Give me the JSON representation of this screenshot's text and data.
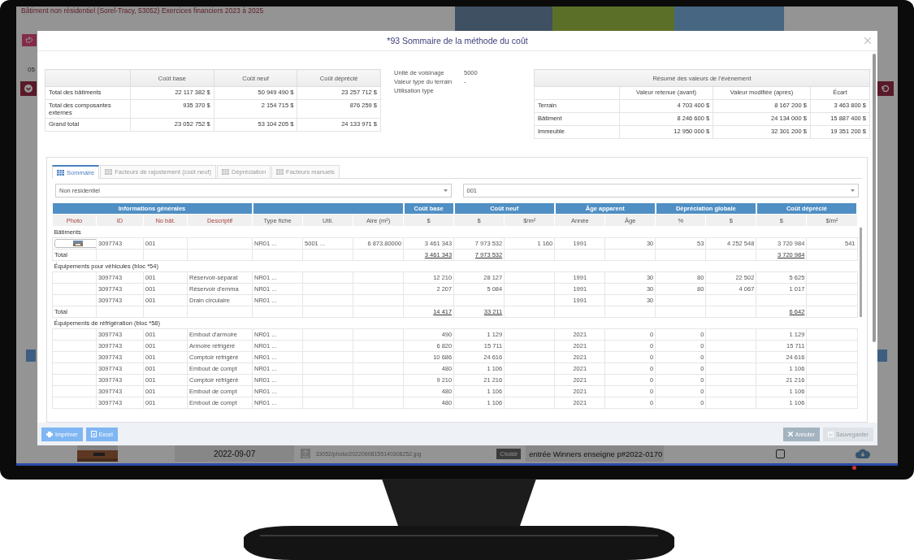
{
  "background": {
    "title": "Bâtiment non résidentiel (Sorel-Tracy, 53052) Exercices financiers 2023 à 2025",
    "number": "05",
    "bottom_row": {
      "date": "2022-09-07",
      "file": "33052/photo/20220908155140308252.jpg",
      "choose_button": "Choisir",
      "description": "entrée Winners enseigne p#2022-0170",
      "checked": false
    }
  },
  "modal": {
    "title": "*93 Sommaire de la méthode du coût",
    "cost_table": {
      "columns": [
        "Coût base",
        "Coût neuf",
        "Coût déprécié"
      ],
      "rows": [
        {
          "label": "Total des bâtiments",
          "values": [
            "22 117 382 $",
            "50 949 490 $",
            "23 257 712 $"
          ]
        },
        {
          "label": "Total des composantes externes",
          "values": [
            "935 370 $",
            "2 154 715 $",
            "876 259 $"
          ]
        },
        {
          "label": "Grand total",
          "values": [
            "23 052 752 $",
            "53 104 205 $",
            "24 133 971 $"
          ]
        }
      ]
    },
    "info": [
      {
        "label": "Unité de voisinage",
        "value": "5000"
      },
      {
        "label": "Valeur type du terrain",
        "value": "-"
      },
      {
        "label": "Utilisation type"
      }
    ],
    "event_table": {
      "title": "Résumé des valeurs de l'évènement",
      "columns": [
        "Valeur retenue (avant)",
        "Valeur modifiée (après)",
        "Écart"
      ],
      "rows": [
        {
          "label": "Terrain",
          "values": [
            "4 703 400 $",
            "8 167 200 $",
            "3 463 800 $"
          ]
        },
        {
          "label": "Bâtiment",
          "values": [
            "8 246 600 $",
            "24 134 000 $",
            "15 887 400 $"
          ]
        },
        {
          "label": "Immeuble",
          "values": [
            "12 950 000 $",
            "32 301 200 $",
            "19 351 200 $"
          ]
        }
      ]
    },
    "tabs": [
      {
        "label": "Sommaire",
        "selected": true
      },
      {
        "label": "Facteurs de rajustement (coût neuf)",
        "selected": false
      },
      {
        "label": "Dépréciation",
        "selected": false
      },
      {
        "label": "Facteurs manuels",
        "selected": false
      }
    ],
    "selects": [
      {
        "value": "Non résidentiel"
      },
      {
        "value": "001"
      }
    ],
    "grid": {
      "groups": [
        {
          "label": "Informations générales",
          "columns": [
            {
              "label": "Photo",
              "kind": "key"
            },
            {
              "label": "ID",
              "kind": "key"
            },
            {
              "label": "No bât.",
              "kind": "key"
            },
            {
              "label": "Descriptif",
              "kind": "key"
            }
          ]
        },
        {
          "columns": [
            {
              "label": "Type fiche",
              "kind": "data"
            },
            {
              "label": "Util.",
              "kind": "data"
            },
            {
              "label": "Aire (m²)",
              "kind": "data"
            }
          ]
        },
        {
          "label": "Coût base",
          "columns": [
            {
              "label": "$",
              "kind": "data"
            }
          ]
        },
        {
          "label": "Coût neuf",
          "columns": [
            {
              "label": "$",
              "kind": "data"
            },
            {
              "label": "$/m²",
              "kind": "data"
            }
          ]
        },
        {
          "label": "Âge apparent",
          "columns": [
            {
              "label": "Année",
              "kind": "data"
            },
            {
              "label": "Âge",
              "kind": "data"
            }
          ]
        },
        {
          "label": "Dépréciation globale",
          "columns": [
            {
              "label": "%",
              "kind": "data"
            },
            {
              "label": "$",
              "kind": "data"
            }
          ]
        },
        {
          "label": "Coût déprécié",
          "columns": [
            {
              "label": "$",
              "kind": "data"
            },
            {
              "label": "$/m²",
              "kind": "data"
            }
          ]
        }
      ],
      "sections": [
        {
          "title": "Bâtiments",
          "rows": [
            {
              "photo": true,
              "cells": [
                "3097743",
                "001",
                null,
                "NR01 ...",
                "5001 ...",
                "6 873.80000",
                "3 461 343",
                "7 973 532",
                "1 160",
                "1991",
                "30",
                "53",
                "4 252 548",
                "3 720 984",
                "541"
              ]
            }
          ],
          "total": {
            "label": "Total",
            "cells": [
              null,
              null,
              null,
              null,
              null,
              null,
              "3 461 343",
              "7 973 532",
              null,
              null,
              null,
              null,
              null,
              "3 720 984",
              null
            ]
          }
        },
        {
          "title": "Équipements pour véhicules (bloc *54)",
          "rows": [
            {
              "photo": false,
              "cells": [
                "3097743",
                "001",
                "Réservoir-séparat",
                "NR01 ...",
                null,
                null,
                "12 210",
                "28 127",
                null,
                "1991",
                "30",
                "80",
                "22 502",
                "5 625",
                null
              ]
            },
            {
              "photo": false,
              "cells": [
                "3097743",
                "001",
                "Réservoir d'emma",
                "NR01 ...",
                null,
                null,
                "2 207",
                "5 084",
                null,
                "1991",
                "30",
                "80",
                "4 067",
                "1 017",
                null
              ]
            },
            {
              "photo": false,
              "cells": [
                "3097743",
                "001",
                "Drain circulaire",
                "NR01 ...",
                null,
                null,
                null,
                null,
                null,
                "1991",
                "30",
                null,
                null,
                null,
                null
              ]
            }
          ],
          "total": {
            "label": "Total",
            "cells": [
              null,
              null,
              null,
              null,
              null,
              null,
              "14 417",
              "33 211",
              null,
              null,
              null,
              null,
              null,
              "6 642",
              null
            ]
          }
        },
        {
          "title": "Équipements de réfrigération (bloc *58)",
          "rows": [
            {
              "photo": false,
              "cells": [
                "3097743",
                "001",
                "Embout d'armoire",
                "NR01 ...",
                null,
                null,
                "490",
                "1 129",
                null,
                "2021",
                "0",
                "0",
                null,
                "1 129",
                null
              ]
            },
            {
              "photo": false,
              "cells": [
                "3097743",
                "001",
                "Armoire réfrigéré",
                "NR01 ...",
                null,
                null,
                "6 820",
                "15 711",
                null,
                "2021",
                "0",
                "0",
                null,
                "15 711",
                null
              ]
            },
            {
              "photo": false,
              "cells": [
                "3097743",
                "001",
                "Comptoir réfrigéré",
                "NR01 ...",
                null,
                null,
                "10 686",
                "24 616",
                null,
                "2021",
                "0",
                "0",
                null,
                "24 616",
                null
              ]
            },
            {
              "photo": false,
              "cells": [
                "3097743",
                "001",
                "Embout de compt",
                "NR01 ...",
                null,
                null,
                "480",
                "1 106",
                null,
                "2021",
                "0",
                "0",
                null,
                "1 106",
                null
              ]
            },
            {
              "photo": false,
              "cells": [
                "3097743",
                "001",
                "Comptoir réfrigéré",
                "NR01 ...",
                null,
                null,
                "9 210",
                "21 216",
                null,
                "2021",
                "0",
                "0",
                null,
                "21 216",
                null
              ]
            },
            {
              "photo": false,
              "cells": [
                "3097743",
                "001",
                "Embout de compt",
                "NR01 ...",
                null,
                null,
                "480",
                "1 106",
                null,
                "2021",
                "0",
                "0",
                null,
                "1 106",
                null
              ]
            },
            {
              "photo": false,
              "cells": [
                "3097743",
                "001",
                "Embout de compt",
                "NR01 ...",
                null,
                null,
                "480",
                "1 106",
                null,
                "2021",
                "0",
                "0",
                null,
                "1 106",
                null
              ]
            }
          ]
        }
      ]
    },
    "footer_left": [
      {
        "label": "Imprimer",
        "kind": "print",
        "disabled": false
      },
      {
        "label": "Excel",
        "kind": "excel",
        "disabled": false
      }
    ],
    "footer_right": [
      {
        "label": "Annuler",
        "kind": "cancel",
        "disabled": false
      },
      {
        "label": "Sauvegarder",
        "kind": "save",
        "disabled": true
      }
    ]
  }
}
